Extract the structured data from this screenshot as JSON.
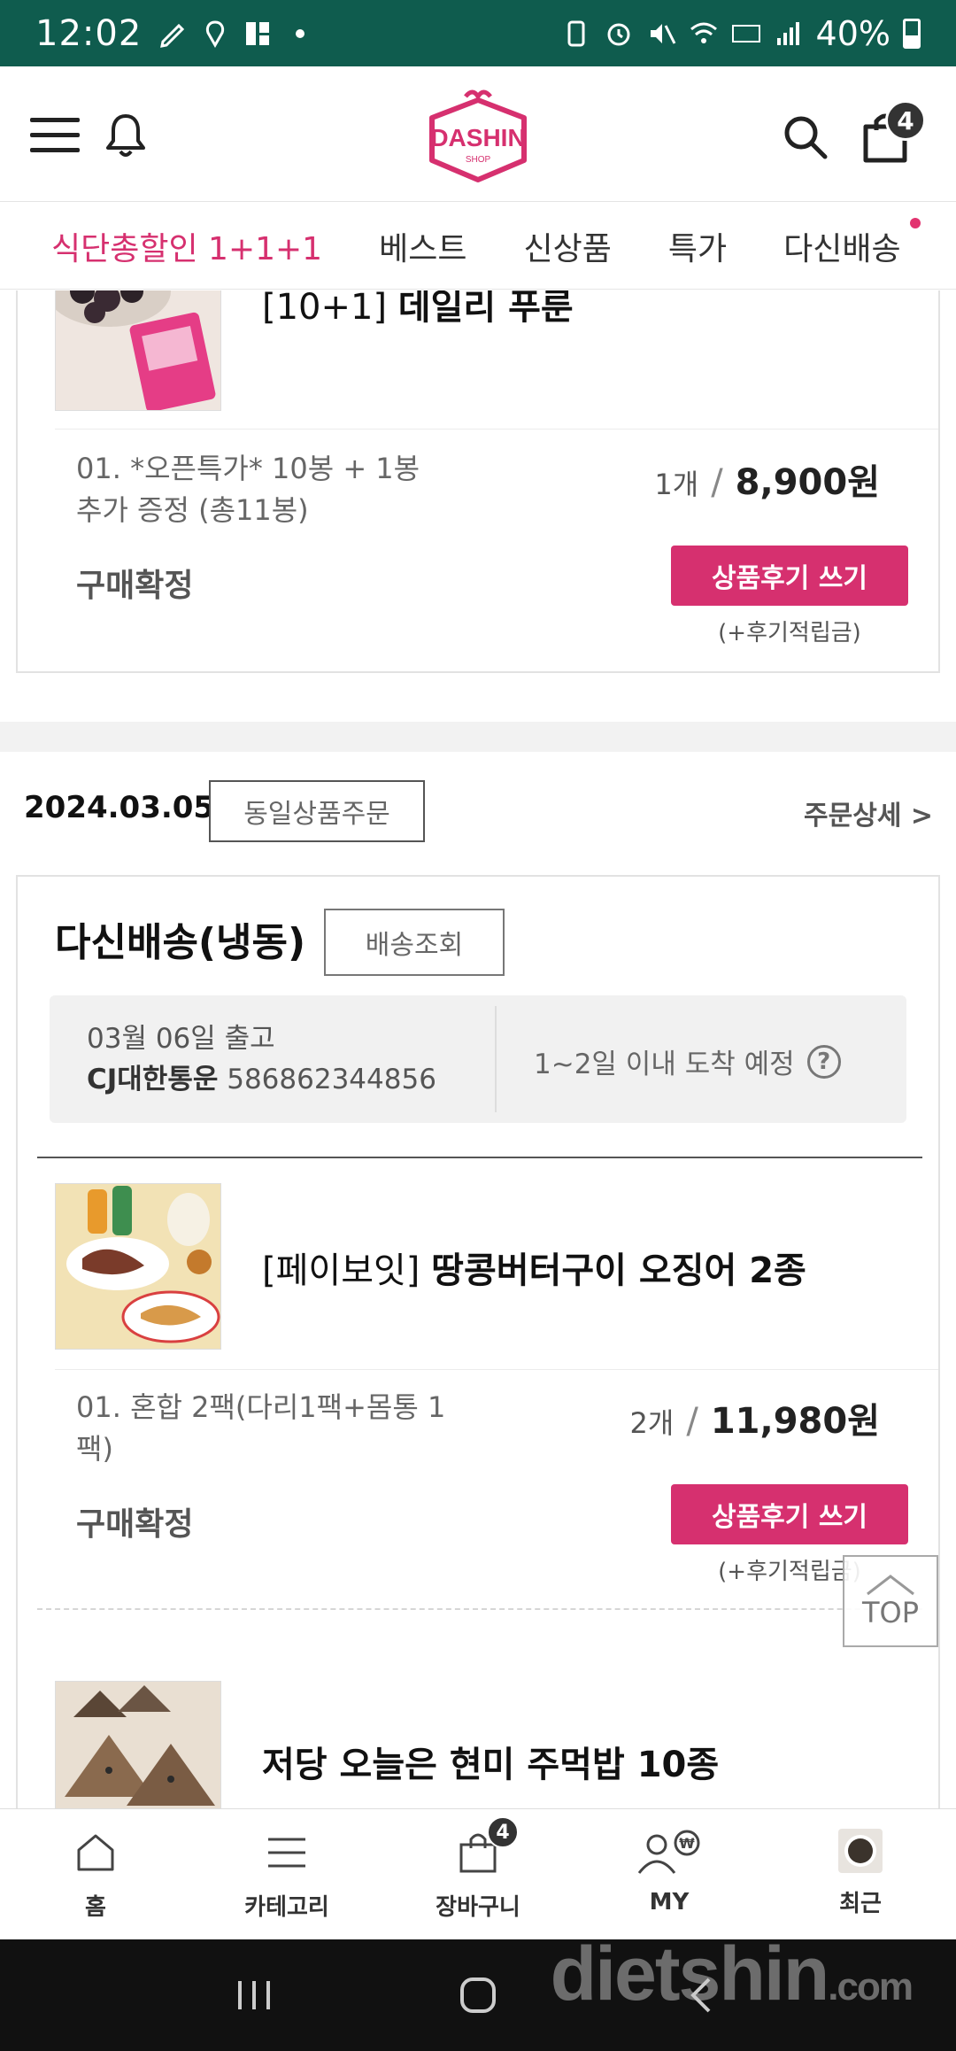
{
  "status_bar": {
    "time": "12:02",
    "battery": "40%"
  },
  "header": {
    "logo_text": "DASHIN",
    "logo_sub": "SHOP",
    "cart_count": "4"
  },
  "tabs": [
    {
      "label": "식단총할인 1+1+1",
      "active": true
    },
    {
      "label": "베스트"
    },
    {
      "label": "신상품"
    },
    {
      "label": "특가"
    },
    {
      "label": "다신배송",
      "dot": true
    }
  ],
  "orders": [
    {
      "product": {
        "brand": "[10+1]",
        "name": "데일리 푸룬"
      },
      "option": "01. *오픈특가* 10봉 + 1봉 추가 증정 (총11봉)",
      "qty": "1개",
      "price": "8,900원",
      "status": "구매확정",
      "review_label": "상품후기 쓰기",
      "review_sub": "(+후기적립금)"
    }
  ],
  "order_group": {
    "date": "2024.03.05",
    "same_order_label": "동일상품주문",
    "detail_label": "주문상세 >",
    "shipping_title": "다신배송(냉동)",
    "track_label": "배송조회",
    "ship_date": "03월 06일 출고",
    "carrier": "CJ대한통운",
    "tracking_no": "586862344856",
    "eta": "1~2일 이내 도착 예정",
    "items": [
      {
        "brand": "[페이보잇]",
        "name": "땅콩버터구이 오징어 2종",
        "option": "01. 혼합 2팩(다리1팩+몸통 1팩)",
        "qty": "2개",
        "price": "11,980원",
        "status": "구매확정",
        "review_label": "상품후기 쓰기",
        "review_sub": "(+후기적립금)"
      },
      {
        "brand": "",
        "name": "저당 오늘은 현미 주먹밥 10종"
      }
    ]
  },
  "top_button": "TOP",
  "bottom_nav": [
    {
      "label": "홈",
      "icon": "home-icon"
    },
    {
      "label": "카테고리",
      "icon": "category-icon"
    },
    {
      "label": "장바구니",
      "icon": "cart-icon",
      "badge": "4"
    },
    {
      "label": "MY",
      "icon": "my-icon"
    },
    {
      "label": "최근",
      "icon": "recent-icon"
    }
  ],
  "watermark": {
    "main": "dietshin",
    "suffix": ".com"
  },
  "colors": {
    "brand_pink": "#d6306f",
    "status_bar": "#0f5c4e"
  }
}
